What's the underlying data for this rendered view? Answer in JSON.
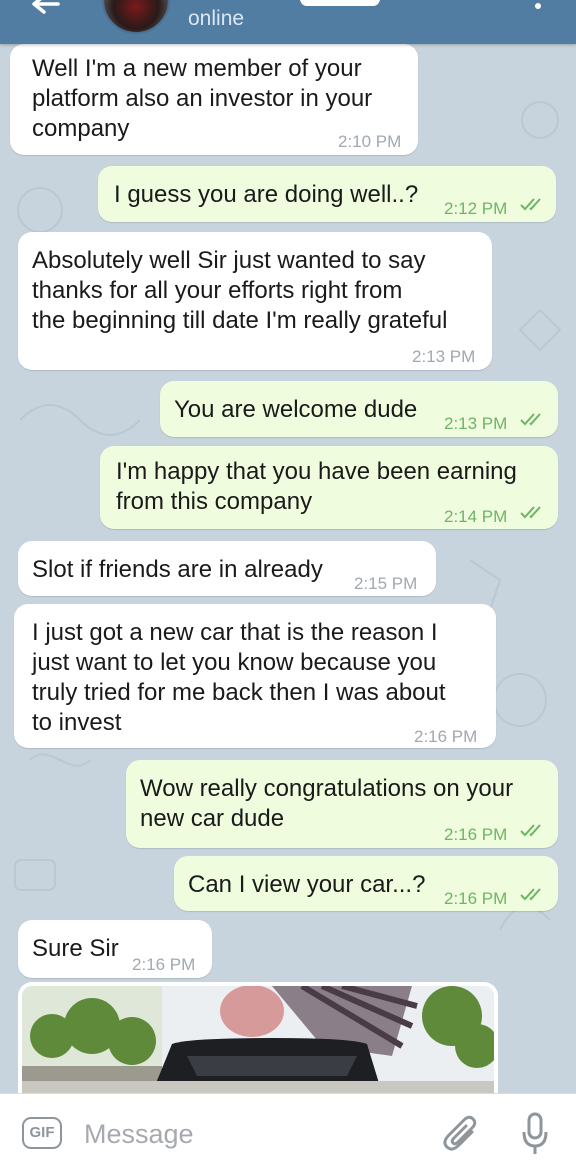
{
  "header": {
    "status": "online"
  },
  "messages": [
    {
      "dir": "in",
      "text_lines": [
        "Well I'm a new member of your",
        "platform also an investor in your",
        "company"
      ],
      "time": "2:10 PM"
    },
    {
      "dir": "out",
      "text_lines": [
        "I guess you are doing well..?"
      ],
      "time": "2:12 PM"
    },
    {
      "dir": "in",
      "text_lines": [
        "Absolutely well Sir just wanted to say",
        "thanks for all your efforts right from",
        "the beginning till date I'm really grateful"
      ],
      "time": "2:13 PM"
    },
    {
      "dir": "out",
      "text_lines": [
        "You are welcome dude"
      ],
      "time": "2:13 PM"
    },
    {
      "dir": "out",
      "text_lines": [
        "I'm happy that you have been earning",
        "from this company"
      ],
      "time": "2:14 PM"
    },
    {
      "dir": "in",
      "text_lines": [
        "Slot if friends are in already"
      ],
      "time": "2:15 PM"
    },
    {
      "dir": "in",
      "text_lines": [
        "I just got a new car that is the reason I",
        "just want to let you know because you",
        "truly tried for me back then I was about",
        "to invest"
      ],
      "time": "2:16 PM"
    },
    {
      "dir": "out",
      "text_lines": [
        "Wow really congratulations on your",
        "new car dude"
      ],
      "time": "2:16 PM"
    },
    {
      "dir": "out",
      "text_lines": [
        "Can I view your car...?"
      ],
      "time": "2:16 PM"
    },
    {
      "dir": "in",
      "text_lines": [
        "Sure Sir"
      ],
      "time": "2:16 PM"
    }
  ],
  "composer": {
    "gif_label": "GIF",
    "placeholder": "Message"
  },
  "colors": {
    "header": "#527da3",
    "incoming_bubble": "#ffffff",
    "outgoing_bubble": "#effdde",
    "chat_background": "#c7d4de",
    "read_ticks": "#6fb466"
  },
  "icons": [
    "back-arrow-icon",
    "more-vertical-icon",
    "double-check-icon",
    "gif-icon",
    "paperclip-icon",
    "microphone-icon"
  ]
}
